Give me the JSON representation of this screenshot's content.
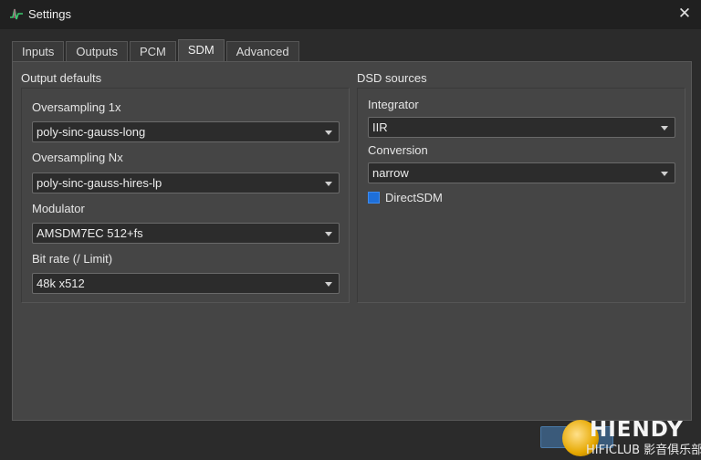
{
  "window": {
    "title": "Settings",
    "close_glyph": "✕"
  },
  "tabs": [
    {
      "label": "Inputs",
      "active": false
    },
    {
      "label": "Outputs",
      "active": false
    },
    {
      "label": "PCM",
      "active": false
    },
    {
      "label": "SDM",
      "active": true
    },
    {
      "label": "Advanced",
      "active": false
    }
  ],
  "output_defaults": {
    "title": "Output defaults",
    "oversampling_1x": {
      "label": "Oversampling 1x",
      "value": "poly-sinc-gauss-long"
    },
    "oversampling_nx": {
      "label": "Oversampling Nx",
      "value": "poly-sinc-gauss-hires-lp"
    },
    "modulator": {
      "label": "Modulator",
      "value": "AMSDM7EC 512+fs"
    },
    "bit_rate": {
      "label": "Bit rate (/ Limit)",
      "value": "48k x512"
    }
  },
  "dsd_sources": {
    "title": "DSD sources",
    "integrator": {
      "label": "Integrator",
      "value": "IIR"
    },
    "conversion": {
      "label": "Conversion",
      "value": "narrow"
    },
    "direct_sdm": {
      "label": "DirectSDM",
      "checked": true
    }
  },
  "watermark": {
    "brand": "HIENDY",
    "sub": "HIFICLUB 影音俱乐部"
  },
  "colors": {
    "accent": "#1e6fd9",
    "titlebar": "#202020",
    "panel": "#454545"
  },
  "icons": {
    "app": "waveform-app-icon",
    "close": "close-icon",
    "dropdown": "chevron-down-icon"
  }
}
